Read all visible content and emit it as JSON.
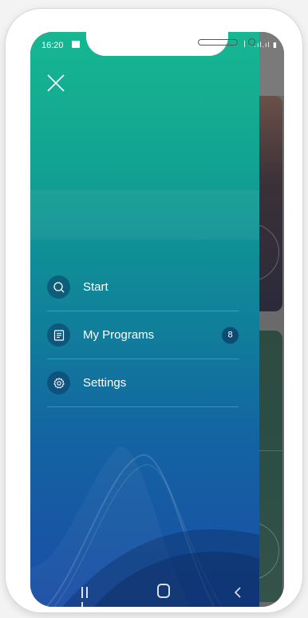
{
  "status_bar": {
    "time": "16:20",
    "right_icons": "ꟾ 𝄈 .ıl.ıl ▮"
  },
  "drawer": {
    "close_icon": "close-icon",
    "menu": [
      {
        "label": "Start",
        "icon": "search-icon"
      },
      {
        "label": "My Programs",
        "icon": "list-icon",
        "badge": "8"
      },
      {
        "label": "Settings",
        "icon": "gear-icon"
      }
    ],
    "colors": {
      "gradient_top": "#16b792",
      "gradient_bottom": "#1a4ea6",
      "icon_bg": "#0c2c56"
    }
  },
  "nav_bar": {
    "recents_icon": "recents-icon",
    "home_icon": "home-icon",
    "back_icon": "back-icon"
  }
}
